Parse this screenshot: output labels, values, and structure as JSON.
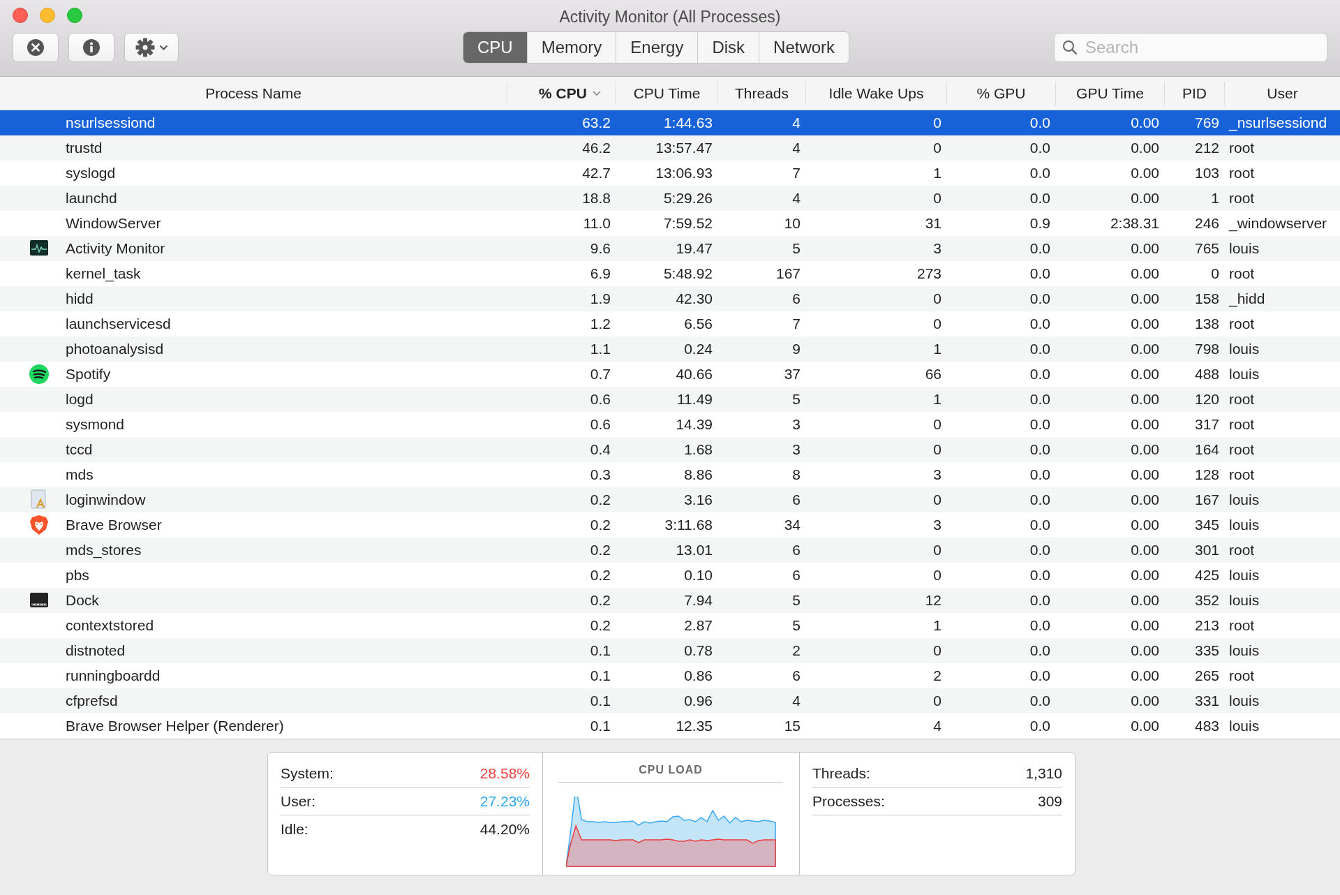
{
  "window": {
    "title": "Activity Monitor (All Processes)"
  },
  "tabs": [
    {
      "label": "CPU",
      "selected": true
    },
    {
      "label": "Memory",
      "selected": false
    },
    {
      "label": "Energy",
      "selected": false
    },
    {
      "label": "Disk",
      "selected": false
    },
    {
      "label": "Network",
      "selected": false
    }
  ],
  "search": {
    "placeholder": "Search"
  },
  "table": {
    "columns": [
      {
        "label": "Process Name",
        "sorted": false
      },
      {
        "label": "% CPU",
        "sorted": true
      },
      {
        "label": "CPU Time",
        "sorted": false
      },
      {
        "label": "Threads",
        "sorted": false
      },
      {
        "label": "Idle Wake Ups",
        "sorted": false
      },
      {
        "label": "% GPU",
        "sorted": false
      },
      {
        "label": "GPU Time",
        "sorted": false
      },
      {
        "label": "PID",
        "sorted": false
      },
      {
        "label": "User",
        "sorted": false
      }
    ],
    "rows": [
      {
        "kind": "plain",
        "selected": true,
        "cells": [
          "nsurlsessiond",
          "63.2",
          "1:44.63",
          "4",
          "0",
          "0.0",
          "0.00",
          "769",
          "_nsurlsessiond"
        ]
      },
      {
        "kind": "plain",
        "selected": false,
        "cells": [
          "trustd",
          "46.2",
          "13:57.47",
          "4",
          "0",
          "0.0",
          "0.00",
          "212",
          "root"
        ]
      },
      {
        "kind": "plain",
        "selected": false,
        "cells": [
          "syslogd",
          "42.7",
          "13:06.93",
          "7",
          "1",
          "0.0",
          "0.00",
          "103",
          "root"
        ]
      },
      {
        "kind": "plain",
        "selected": false,
        "cells": [
          "launchd",
          "18.8",
          "5:29.26",
          "4",
          "0",
          "0.0",
          "0.00",
          "1",
          "root"
        ]
      },
      {
        "kind": "plain",
        "selected": false,
        "cells": [
          "WindowServer",
          "11.0",
          "7:59.52",
          "10",
          "31",
          "0.9",
          "2:38.31",
          "246",
          "_windowserver"
        ]
      },
      {
        "kind": "monitor",
        "selected": false,
        "cells": [
          "Activity Monitor",
          "9.6",
          "19.47",
          "5",
          "3",
          "0.0",
          "0.00",
          "765",
          "louis"
        ]
      },
      {
        "kind": "plain",
        "selected": false,
        "cells": [
          "kernel_task",
          "6.9",
          "5:48.92",
          "167",
          "273",
          "0.0",
          "0.00",
          "0",
          "root"
        ]
      },
      {
        "kind": "plain",
        "selected": false,
        "cells": [
          "hidd",
          "1.9",
          "42.30",
          "6",
          "0",
          "0.0",
          "0.00",
          "158",
          "_hidd"
        ]
      },
      {
        "kind": "plain",
        "selected": false,
        "cells": [
          "launchservicesd",
          "1.2",
          "6.56",
          "7",
          "0",
          "0.0",
          "0.00",
          "138",
          "root"
        ]
      },
      {
        "kind": "plain",
        "selected": false,
        "cells": [
          "photoanalysisd",
          "1.1",
          "0.24",
          "9",
          "1",
          "0.0",
          "0.00",
          "798",
          "louis"
        ]
      },
      {
        "kind": "music",
        "selected": false,
        "cells": [
          "Spotify",
          "0.7",
          "40.66",
          "37",
          "66",
          "0.0",
          "0.00",
          "488",
          "louis"
        ]
      },
      {
        "kind": "plain",
        "selected": false,
        "cells": [
          "logd",
          "0.6",
          "11.49",
          "5",
          "1",
          "0.0",
          "0.00",
          "120",
          "root"
        ]
      },
      {
        "kind": "plain",
        "selected": false,
        "cells": [
          "sysmond",
          "0.6",
          "14.39",
          "3",
          "0",
          "0.0",
          "0.00",
          "317",
          "root"
        ]
      },
      {
        "kind": "plain",
        "selected": false,
        "cells": [
          "tccd",
          "0.4",
          "1.68",
          "3",
          "0",
          "0.0",
          "0.00",
          "164",
          "root"
        ]
      },
      {
        "kind": "plain",
        "selected": false,
        "cells": [
          "mds",
          "0.3",
          "8.86",
          "8",
          "3",
          "0.0",
          "0.00",
          "128",
          "root"
        ]
      },
      {
        "kind": "document",
        "selected": false,
        "cells": [
          "loginwindow",
          "0.2",
          "3.16",
          "6",
          "0",
          "0.0",
          "0.00",
          "167",
          "louis"
        ]
      },
      {
        "kind": "browser",
        "selected": false,
        "cells": [
          "Brave Browser",
          "0.2",
          "3:11.68",
          "34",
          "3",
          "0.0",
          "0.00",
          "345",
          "louis"
        ]
      },
      {
        "kind": "plain",
        "selected": false,
        "cells": [
          "mds_stores",
          "0.2",
          "13.01",
          "6",
          "0",
          "0.0",
          "0.00",
          "301",
          "root"
        ]
      },
      {
        "kind": "plain",
        "selected": false,
        "cells": [
          "pbs",
          "0.2",
          "0.10",
          "6",
          "0",
          "0.0",
          "0.00",
          "425",
          "louis"
        ]
      },
      {
        "kind": "dock",
        "selected": false,
        "cells": [
          "Dock",
          "0.2",
          "7.94",
          "5",
          "12",
          "0.0",
          "0.00",
          "352",
          "louis"
        ]
      },
      {
        "kind": "plain",
        "selected": false,
        "cells": [
          "contextstored",
          "0.2",
          "2.87",
          "5",
          "1",
          "0.0",
          "0.00",
          "213",
          "root"
        ]
      },
      {
        "kind": "plain",
        "selected": false,
        "cells": [
          "distnoted",
          "0.1",
          "0.78",
          "2",
          "0",
          "0.0",
          "0.00",
          "335",
          "louis"
        ]
      },
      {
        "kind": "plain",
        "selected": false,
        "cells": [
          "runningboardd",
          "0.1",
          "0.86",
          "6",
          "2",
          "0.0",
          "0.00",
          "265",
          "root"
        ]
      },
      {
        "kind": "plain",
        "selected": false,
        "cells": [
          "cfprefsd",
          "0.1",
          "0.96",
          "4",
          "0",
          "0.0",
          "0.00",
          "331",
          "louis"
        ]
      },
      {
        "kind": "plain",
        "selected": false,
        "cells": [
          "Brave Browser Helper (Renderer)",
          "0.1",
          "12.35",
          "15",
          "4",
          "0.0",
          "0.00",
          "483",
          "louis"
        ]
      }
    ]
  },
  "summary": {
    "load": [
      {
        "label": "System:",
        "value": "28.58%",
        "color": "#f2403a"
      },
      {
        "label": "User:",
        "value": "27.23%",
        "color": "#2aa7ef"
      },
      {
        "label": "Idle:",
        "value": "44.20%",
        "color": "#222222"
      }
    ],
    "chart_title": "CPU LOAD",
    "counts": [
      {
        "label": "Threads:",
        "value": "1,310"
      },
      {
        "label": "Processes:",
        "value": "309"
      }
    ]
  }
}
